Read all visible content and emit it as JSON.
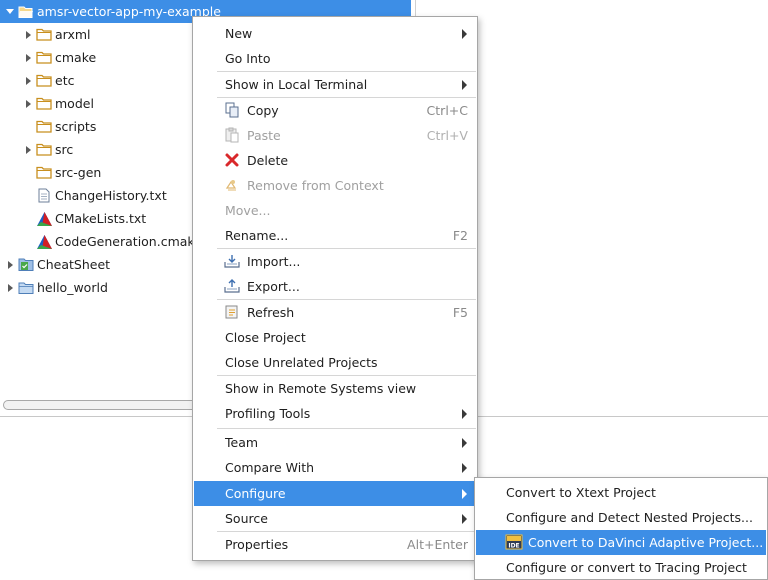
{
  "explorer": {
    "root": "amsr-vector-app-my-example",
    "children": [
      {
        "label": "arxml",
        "expandable": true
      },
      {
        "label": "cmake",
        "expandable": true
      },
      {
        "label": "etc",
        "expandable": true
      },
      {
        "label": "model",
        "expandable": true
      },
      {
        "label": "scripts",
        "expandable": false
      },
      {
        "label": "src",
        "expandable": true
      },
      {
        "label": "src-gen",
        "expandable": false
      }
    ],
    "files": [
      "ChangeHistory.txt",
      "CMakeLists.txt",
      "CodeGeneration.cmake"
    ],
    "projects": [
      "CheatSheet",
      "hello_world"
    ]
  },
  "context_menu": {
    "new": "New",
    "go_into": "Go Into",
    "show_local_terminal": "Show in Local Terminal",
    "copy": "Copy",
    "copy_sc": "Ctrl+C",
    "paste": "Paste",
    "paste_sc": "Ctrl+V",
    "delete": "Delete",
    "remove_context": "Remove from Context",
    "move": "Move...",
    "rename": "Rename...",
    "rename_sc": "F2",
    "import": "Import...",
    "export": "Export...",
    "refresh": "Refresh",
    "refresh_sc": "F5",
    "close_project": "Close Project",
    "close_unrelated": "Close Unrelated Projects",
    "show_remote": "Show in Remote Systems view",
    "profiling": "Profiling Tools",
    "team": "Team",
    "compare_with": "Compare With",
    "configure": "Configure",
    "source": "Source",
    "properties": "Properties",
    "properties_sc": "Alt+Enter"
  },
  "configure_submenu": {
    "xtext": "Convert to Xtext Project",
    "nested": "Configure and Detect Nested Projects...",
    "davinci": "Convert to DaVinci Adaptive Project...",
    "tracing": "Configure or convert to Tracing Project"
  },
  "colors": {
    "selection": "#3d8ee6",
    "folder": "#e8b64a"
  }
}
